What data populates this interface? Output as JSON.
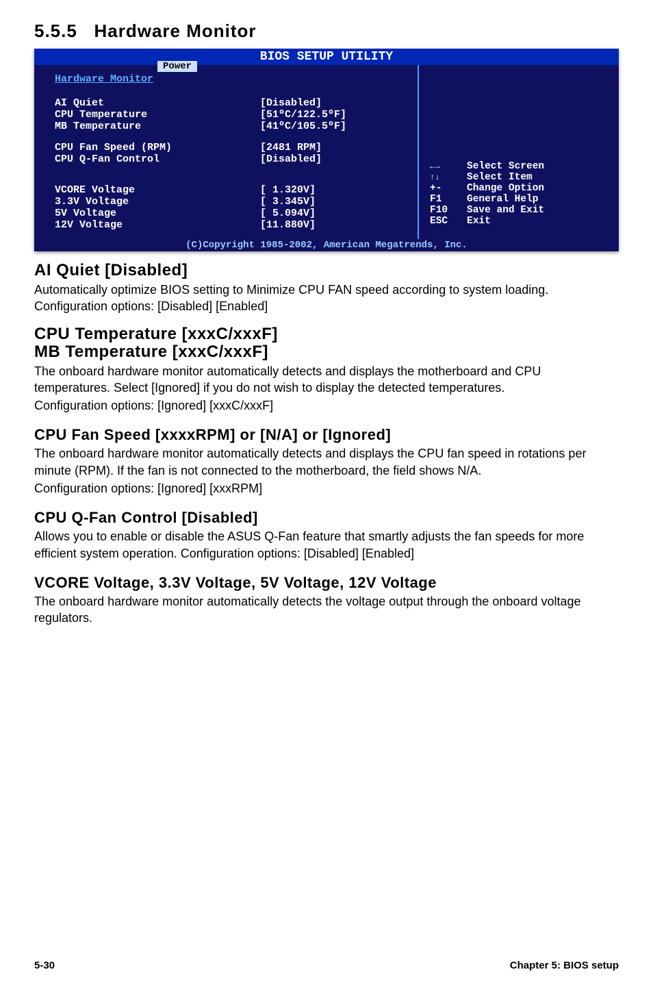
{
  "section_number": "5.5.5",
  "section_title": "Hardware Monitor",
  "bios": {
    "title": "BIOS SETUP UTILITY",
    "tab": "Power",
    "group_title": "Hardware Monitor",
    "rows": [
      {
        "label": "AI Quiet",
        "value": "[Disabled]"
      },
      {
        "label": "CPU Temperature",
        "value": "[51ºC/122.5ºF]"
      },
      {
        "label": "MB Temperature",
        "value": "[41ºC/105.5ºF]"
      }
    ],
    "rows2": [
      {
        "label": "CPU Fan Speed (RPM)",
        "value": "[2481 RPM]"
      },
      {
        "label": "CPU Q-Fan Control",
        "value": "[Disabled]"
      }
    ],
    "rows3": [
      {
        "label": "VCORE Voltage",
        "value": "[ 1.320V]"
      },
      {
        "label": "3.3V Voltage",
        "value": "[ 3.345V]"
      },
      {
        "label": "5V Voltage",
        "value": "[ 5.094V]"
      },
      {
        "label": "12V Voltage",
        "value": "[11.880V]"
      }
    ],
    "help": [
      {
        "key": "←→",
        "text": "Select Screen"
      },
      {
        "key": "↑↓",
        "text": "Select Item"
      },
      {
        "key": "+-",
        "text": "Change Option"
      },
      {
        "key": "F1",
        "text": "General Help"
      },
      {
        "key": "F10",
        "text": "Save and Exit"
      },
      {
        "key": "ESC",
        "text": "Exit"
      }
    ],
    "footer": "(C)Copyright 1985-2002, American Megatrends, Inc."
  },
  "items": {
    "ai_quiet": {
      "title": "AI Quiet [Disabled]",
      "text": "Automatically optimize BIOS setting to Minimize CPU FAN speed according to system loading. Configuration options: [Disabled] [Enabled]"
    },
    "temps": {
      "title1": "CPU Temperature [xxxC/xxxF]",
      "title2": "MB Temperature [xxxC/xxxF]",
      "text1": "The onboard hardware monitor automatically detects and displays the motherboard and CPU temperatures. Select [Ignored] if you do not wish to display the detected temperatures.",
      "text2": "Configuration options: [Ignored] [xxxC/xxxF]"
    },
    "fan_speed": {
      "title": "CPU Fan Speed [xxxxRPM] or [N/A] or [Ignored]",
      "text1": "The onboard hardware monitor automatically detects and displays the CPU fan speed in rotations per minute (RPM). If the fan is not connected to the motherboard, the field shows N/A.",
      "text2": "Configuration options: [Ignored] [xxxRPM]"
    },
    "qfan": {
      "title": "CPU Q-Fan Control [Disabled]",
      "text": "Allows you to enable or disable the ASUS Q-Fan feature that smartly adjusts the fan speeds for more efficient system operation. Configuration options: [Disabled] [Enabled]"
    },
    "volt": {
      "title": "VCORE Voltage, 3.3V Voltage, 5V Voltage, 12V Voltage",
      "text": "The onboard hardware monitor automatically detects the voltage output through the onboard voltage regulators."
    }
  },
  "footer": {
    "page": "5-30",
    "chapter": "Chapter 5: BIOS setup"
  }
}
